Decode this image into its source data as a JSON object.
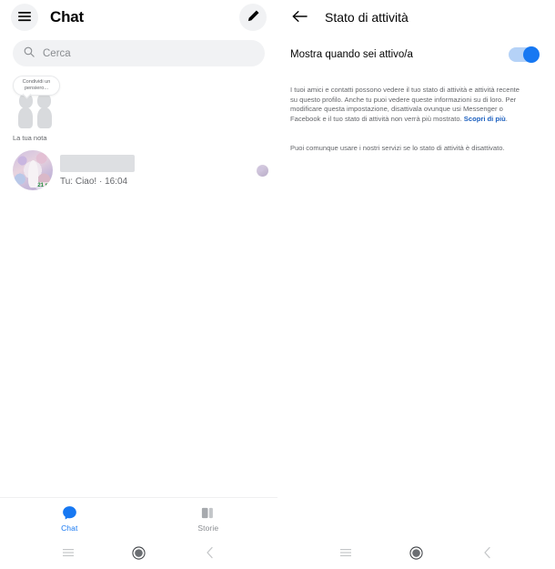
{
  "left_screen": {
    "header": {
      "menu_icon": "hamburger-menu-icon",
      "title": "Chat",
      "compose_icon": "pencil-compose-icon"
    },
    "search": {
      "icon": "search-icon",
      "placeholder": "Cerca",
      "value": ""
    },
    "notes": {
      "bubble_text": "Condividi un pensiero...",
      "label": "La tua nota"
    },
    "conversation": {
      "name": "",
      "snippet": "Tu: Ciao! · 16:04",
      "avatar_badge": "21 m",
      "read_receipt_icon": "read-receipt-avatar"
    },
    "tabs": [
      {
        "label": "Chat",
        "icon": "chat-bubble-icon",
        "active": true
      },
      {
        "label": "Storie",
        "icon": "stories-icon",
        "active": false
      }
    ]
  },
  "right_screen": {
    "header": {
      "back_icon": "arrow-left-icon",
      "title": "Stato di attività"
    },
    "setting": {
      "label": "Mostra quando sei attivo/a",
      "toggle_on": true
    },
    "paragraph_1": "I tuoi amici e contatti possono vedere il tuo stato di attività e attività recente su questo profilo. Anche tu puoi vedere queste informazioni su di loro. Per modificare questa impostazione, disattivala ovunque usi Messenger o Facebook e il tuo stato di attività non verrà più mostrato. ",
    "learn_more": "Scopri di più",
    "paragraph_1_end": ".",
    "paragraph_2": "Puoi comunque usare i nostri servizi se lo stato di attività è disattivato."
  },
  "android_nav": {
    "recents_icon": "recent-apps-icon",
    "home_icon": "home-circle-icon",
    "back_icon": "back-chevron-icon"
  },
  "colors": {
    "accent_blue": "#1778f2",
    "toggle_track": "#b5d2f7",
    "link_blue": "#1b5fbf",
    "badge_green": "#1f8a3a",
    "text_primary": "#050505",
    "text_secondary": "#65676b",
    "surface_gray": "#f1f2f4"
  }
}
